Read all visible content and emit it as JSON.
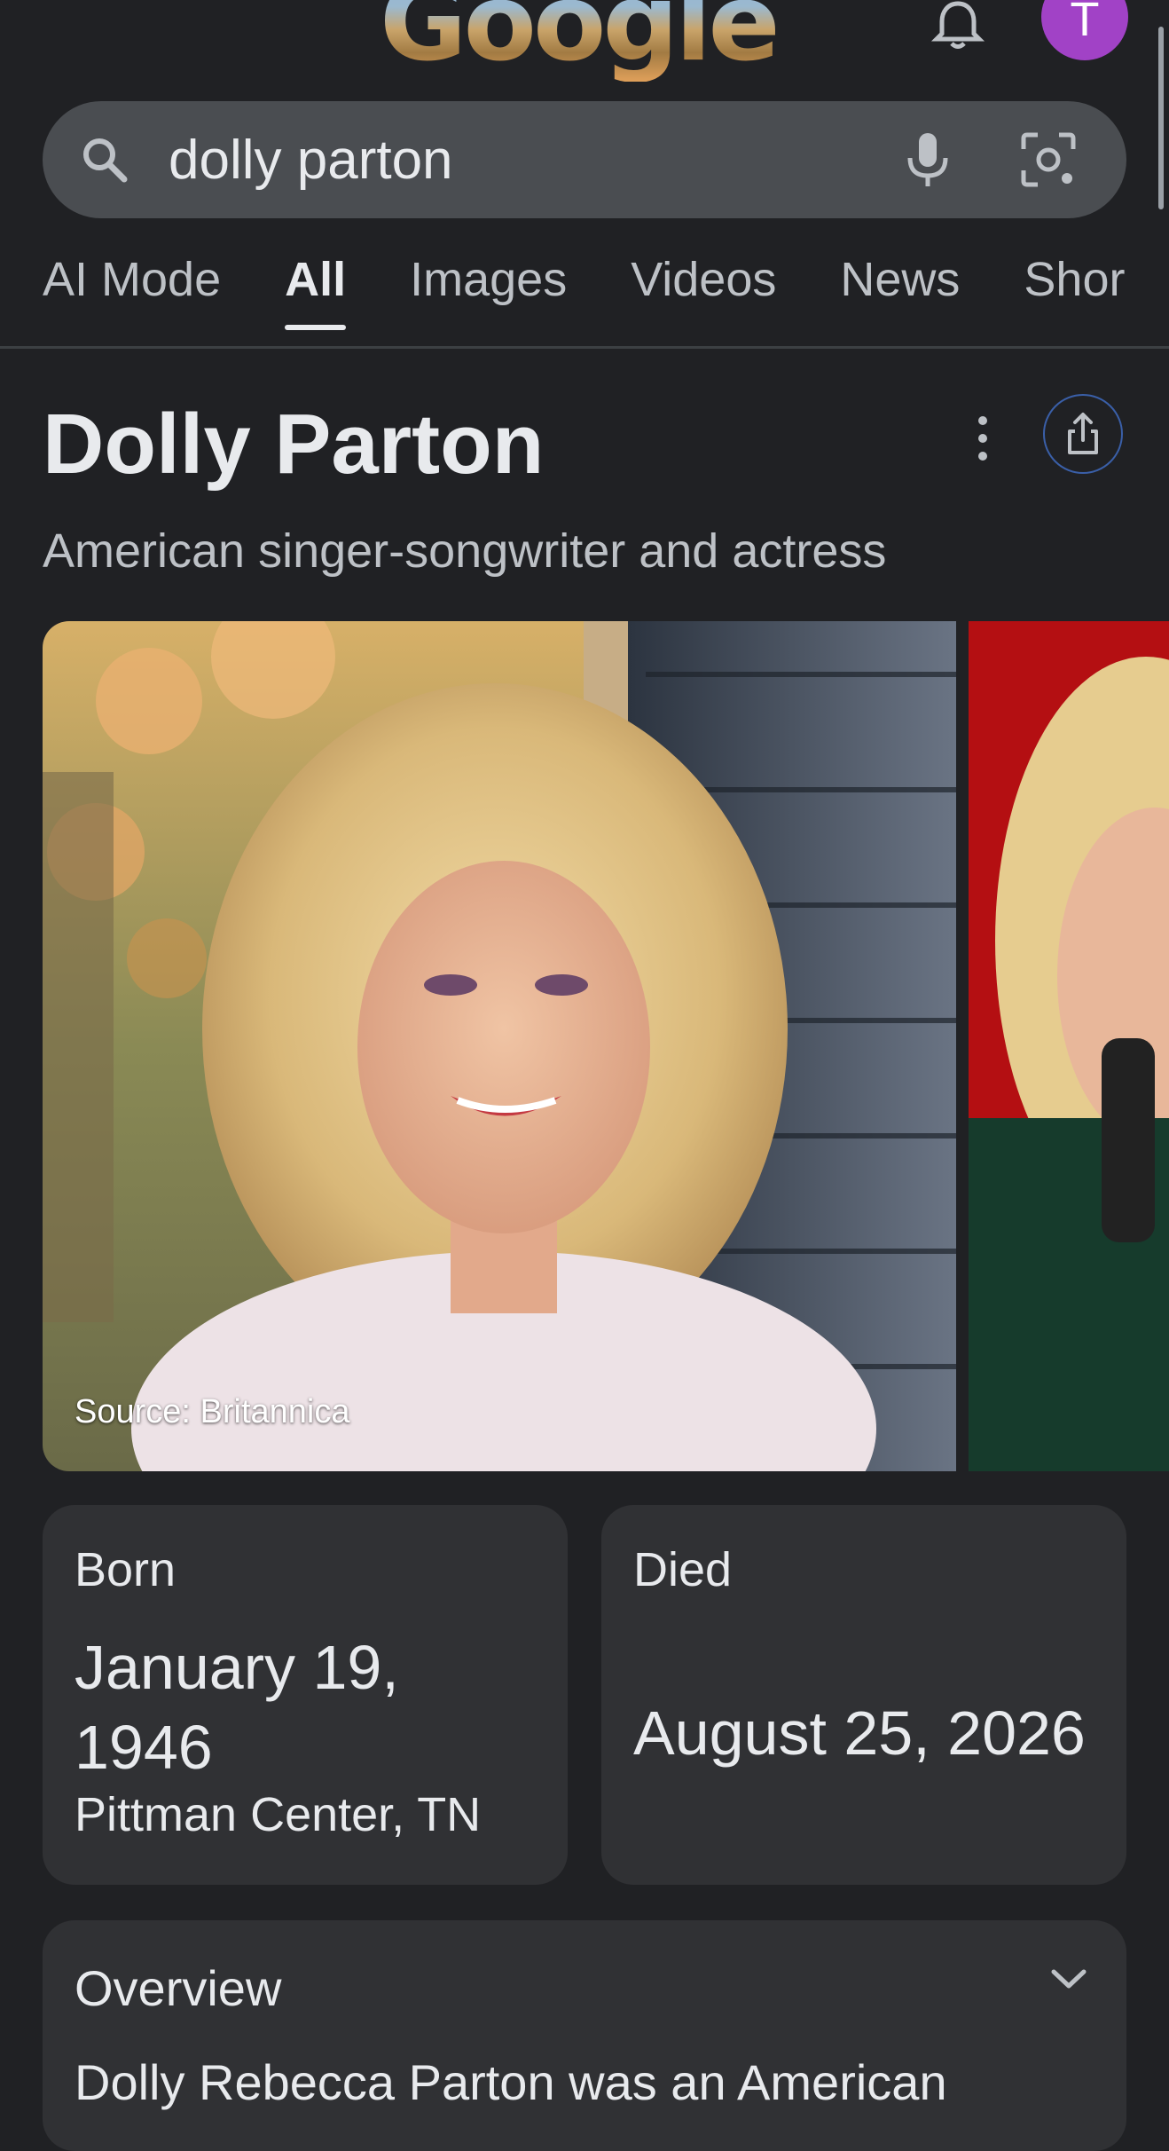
{
  "header": {
    "logo_text": "Google",
    "avatar_initial": "T"
  },
  "search": {
    "query": "dolly parton",
    "icons": [
      "search-icon",
      "mic-icon",
      "camera-lens-icon"
    ]
  },
  "tabs": [
    {
      "label": "AI Mode",
      "active": false
    },
    {
      "label": "All",
      "active": true
    },
    {
      "label": "Images",
      "active": false
    },
    {
      "label": "Videos",
      "active": false
    },
    {
      "label": "News",
      "active": false
    },
    {
      "label": "Shor",
      "active": false
    }
  ],
  "panel": {
    "title": "Dolly Parton",
    "subtitle": "American singer-songwriter and actress",
    "image_source": "Source: Britannica"
  },
  "facts": {
    "born_label": "Born",
    "born_value": "January 19, 1946",
    "born_place": "Pittman Center, TN",
    "died_label": "Died",
    "died_value": "August 25, 2026"
  },
  "overview": {
    "title": "Overview",
    "text": "Dolly Rebecca Parton was an American"
  },
  "colors": {
    "background": "#202124",
    "card": "#303134",
    "avatar": "#a142c6",
    "share_ring": "#3a5fa8"
  }
}
